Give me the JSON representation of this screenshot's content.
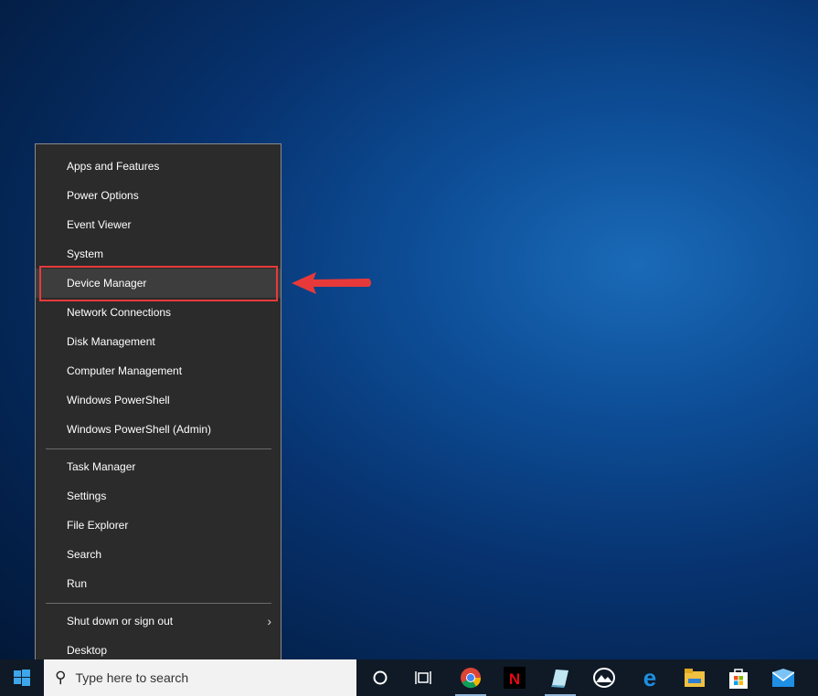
{
  "menu": {
    "items": [
      {
        "label": "Apps and Features"
      },
      {
        "label": "Power Options"
      },
      {
        "label": "Event Viewer"
      },
      {
        "label": "System"
      },
      {
        "label": "Device Manager",
        "highlighted": true
      },
      {
        "label": "Network Connections"
      },
      {
        "label": "Disk Management"
      },
      {
        "label": "Computer Management"
      },
      {
        "label": "Windows PowerShell"
      },
      {
        "label": "Windows PowerShell (Admin)"
      },
      {
        "label": "Task Manager"
      },
      {
        "label": "Settings"
      },
      {
        "label": "File Explorer"
      },
      {
        "label": "Search"
      },
      {
        "label": "Run"
      },
      {
        "label": "Shut down or sign out",
        "submenu": true
      },
      {
        "label": "Desktop"
      }
    ]
  },
  "annotation": {
    "color": "#e8393a"
  },
  "taskbar": {
    "search_placeholder": "Type here to search",
    "icons": [
      "cortana-icon",
      "task-view-icon",
      "chrome-icon",
      "netflix-icon",
      "notes-icon",
      "photos-icon",
      "edge-icon",
      "file-explorer-icon",
      "store-icon",
      "mail-icon"
    ]
  }
}
